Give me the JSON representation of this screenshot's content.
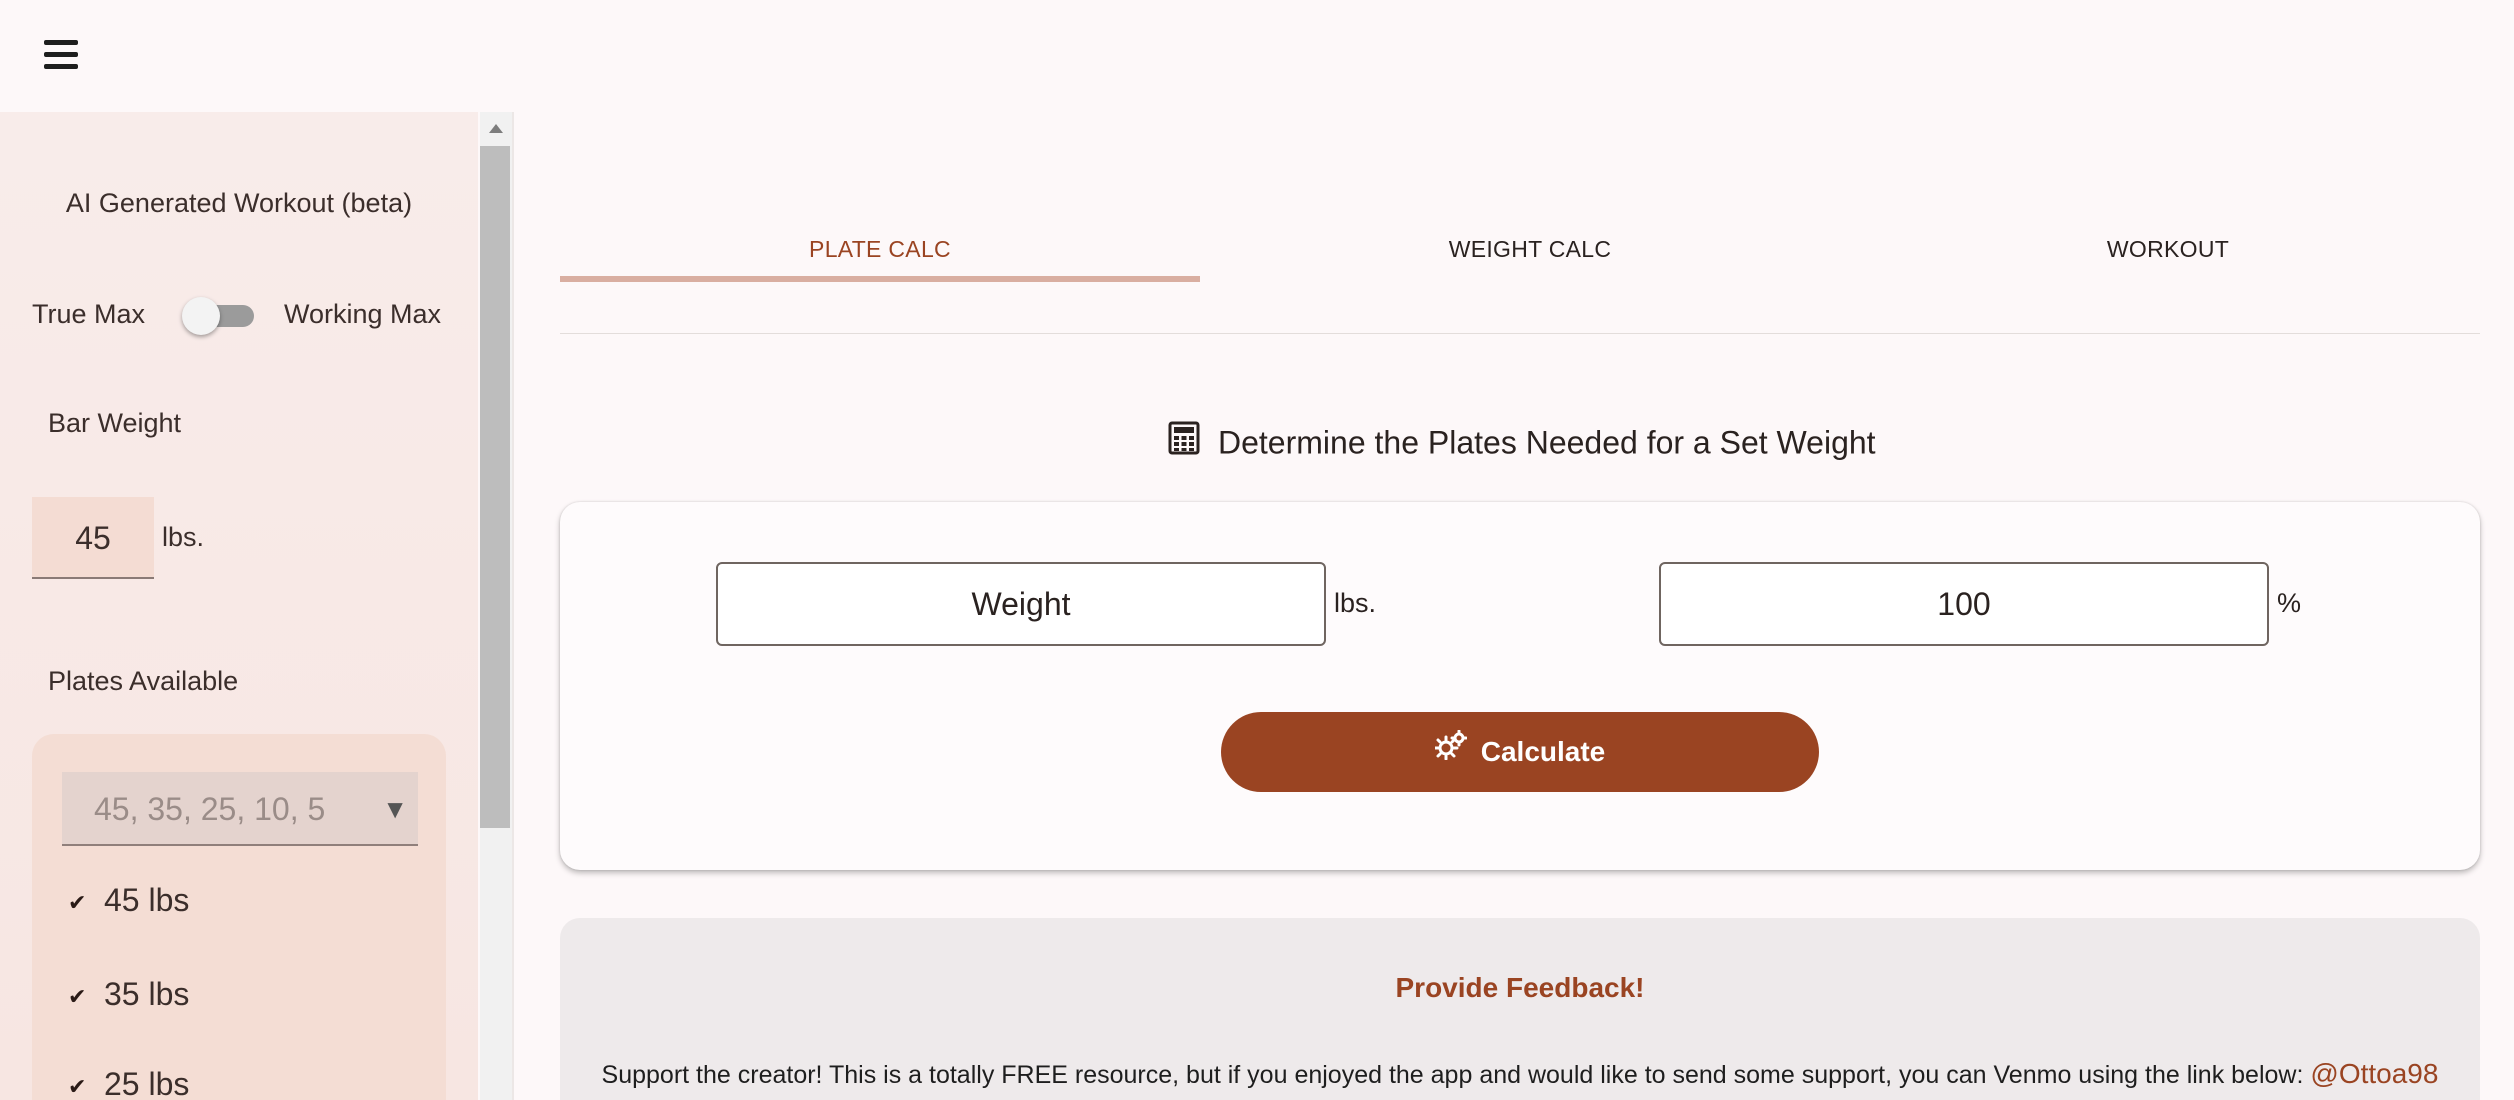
{
  "header": {
    "menu_icon": "hamburger-menu-icon"
  },
  "sidebar": {
    "title": "AI Generated Workout (beta)",
    "toggle": {
      "left_label": "True Max",
      "right_label": "Working Max",
      "state": "off"
    },
    "bar_weight": {
      "label": "Bar Weight",
      "value": "45",
      "unit": "lbs."
    },
    "plates": {
      "label": "Plates Available",
      "selected_summary": "45, 35, 25, 10, 5",
      "options": [
        {
          "label": "45 lbs",
          "checked": true
        },
        {
          "label": "35 lbs",
          "checked": true
        },
        {
          "label": "25 lbs",
          "checked": true
        }
      ]
    }
  },
  "tabs": [
    {
      "label": "PLATE CALC",
      "active": true
    },
    {
      "label": "WEIGHT CALC",
      "active": false
    },
    {
      "label": "WORKOUT",
      "active": false
    }
  ],
  "main": {
    "heading": "Determine the Plates Needed for a Set Weight",
    "heading_icon": "calculator-icon",
    "weight_input": {
      "placeholder": "Weight",
      "unit": "lbs."
    },
    "percent_input": {
      "value": "100",
      "unit": "%"
    },
    "calculate_button": {
      "label": "Calculate",
      "icon": "gears-icon"
    }
  },
  "feedback": {
    "link": "Provide Feedback!",
    "support_text": "Support the creator! This is a totally FREE resource, but if you enjoyed the app and would like to send some support, you can Venmo using the link below:",
    "venmo_handle": "@Ottoa98"
  },
  "colors": {
    "accent": "#9a4422",
    "sidebar_bg": "#f8ecea",
    "panel_bg": "#f4ddd4",
    "page_bg": "#fdf8f9"
  }
}
